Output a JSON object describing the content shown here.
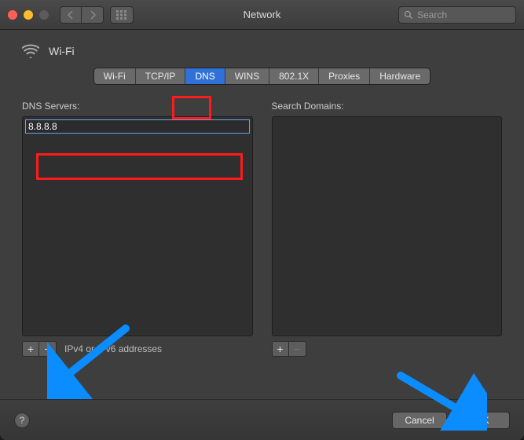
{
  "titlebar": {
    "title": "Network",
    "search_placeholder": "Search"
  },
  "header": {
    "interface": "Wi-Fi"
  },
  "tabs": [
    {
      "label": "Wi-Fi",
      "active": false
    },
    {
      "label": "TCP/IP",
      "active": false
    },
    {
      "label": "DNS",
      "active": true
    },
    {
      "label": "WINS",
      "active": false
    },
    {
      "label": "802.1X",
      "active": false
    },
    {
      "label": "Proxies",
      "active": false
    },
    {
      "label": "Hardware",
      "active": false
    }
  ],
  "dns": {
    "label": "DNS Servers:",
    "entries": [
      "8.8.8.8"
    ],
    "hint": "IPv4 or IPv6 addresses",
    "plus": "+",
    "minus": "−"
  },
  "domains": {
    "label": "Search Domains:",
    "plus": "+",
    "minus": "−"
  },
  "footer": {
    "help": "?",
    "cancel": "Cancel",
    "ok": "OK"
  },
  "annotations": {
    "highlight_color": "#ff1b1b",
    "arrow_color": "#0b8cff"
  }
}
